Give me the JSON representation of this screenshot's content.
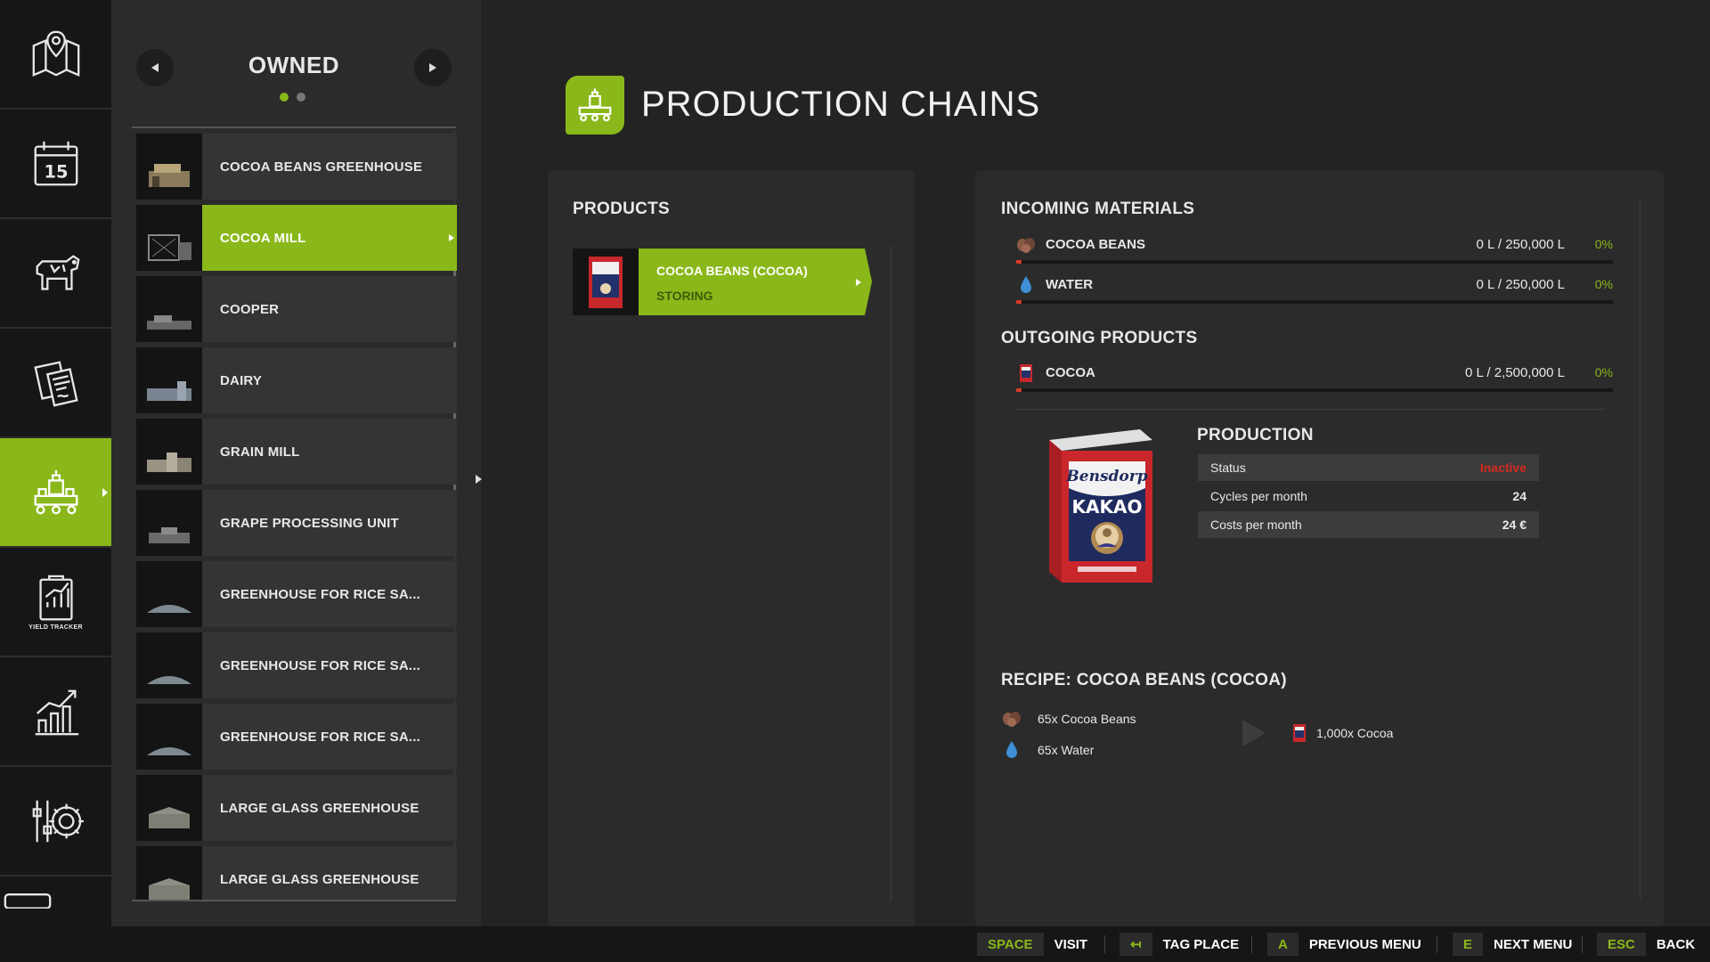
{
  "nav": {
    "items": [
      {
        "icon": "map-icon"
      },
      {
        "icon": "calendar-icon",
        "text": "15"
      },
      {
        "icon": "cow-icon"
      },
      {
        "icon": "contracts-icon"
      },
      {
        "icon": "production-icon",
        "active": true
      },
      {
        "icon": "yield-tracker-icon",
        "sub": "YIELD TRACKER"
      },
      {
        "icon": "statistics-icon"
      },
      {
        "icon": "settings-icon"
      },
      {
        "icon": "more-icon"
      }
    ]
  },
  "list": {
    "title": "OWNED",
    "page_count": 2,
    "current_page": 1,
    "items": [
      {
        "label": "COCOA BEANS GREENHOUSE"
      },
      {
        "label": "COCOA MILL",
        "active": true
      },
      {
        "label": "COOPER"
      },
      {
        "label": "DAIRY"
      },
      {
        "label": "GRAIN MILL"
      },
      {
        "label": "GRAPE PROCESSING UNIT"
      },
      {
        "label": "GREENHOUSE FOR RICE SA..."
      },
      {
        "label": "GREENHOUSE FOR RICE SA..."
      },
      {
        "label": "GREENHOUSE FOR RICE SA..."
      },
      {
        "label": "LARGE GLASS GREENHOUSE"
      },
      {
        "label": "LARGE GLASS GREENHOUSE"
      }
    ]
  },
  "header": {
    "title": "PRODUCTION CHAINS"
  },
  "products": {
    "title": "PRODUCTS",
    "items": [
      {
        "name": "COCOA BEANS (COCOA)",
        "status": "STORING"
      }
    ]
  },
  "incoming": {
    "title": "INCOMING MATERIALS",
    "items": [
      {
        "name": "COCOA BEANS",
        "amount": "0 L / 250,000 L",
        "percent": "0%",
        "fill": 0
      },
      {
        "name": "WATER",
        "amount": "0 L / 250,000 L",
        "percent": "0%",
        "fill": 0
      }
    ]
  },
  "outgoing": {
    "title": "OUTGOING PRODUCTS",
    "items": [
      {
        "name": "COCOA",
        "amount": "0 L / 2,500,000 L",
        "percent": "0%",
        "fill": 0
      }
    ]
  },
  "production": {
    "title": "PRODUCTION",
    "product_image_text": {
      "brand": "Bensdorp",
      "name": "KAKAO"
    },
    "rows": [
      {
        "label": "Status",
        "value": "Inactive"
      },
      {
        "label": "Cycles per month",
        "value": "24"
      },
      {
        "label": "Costs per month",
        "value": "24 €"
      }
    ]
  },
  "recipe": {
    "title": "RECIPE: COCOA BEANS (COCOA)",
    "inputs": [
      {
        "text": "65x Cocoa Beans",
        "icon": "cocoa-beans-icon"
      },
      {
        "text": "65x Water",
        "icon": "water-drop-icon"
      }
    ],
    "output": {
      "text": "1,000x Cocoa",
      "icon": "cocoa-box-icon"
    }
  },
  "footer": {
    "actions": [
      {
        "key": "SPACE",
        "label": "VISIT"
      },
      {
        "key": "↤",
        "label": "TAG PLACE"
      },
      {
        "key": "A",
        "label": "PREVIOUS MENU"
      },
      {
        "key": "E",
        "label": "NEXT MENU"
      },
      {
        "key": "ESC",
        "label": "BACK"
      }
    ]
  },
  "colors": {
    "accent": "#8ab81a",
    "alert": "#d52a1f",
    "background": "#232323",
    "panel": "#2b2b2b"
  }
}
